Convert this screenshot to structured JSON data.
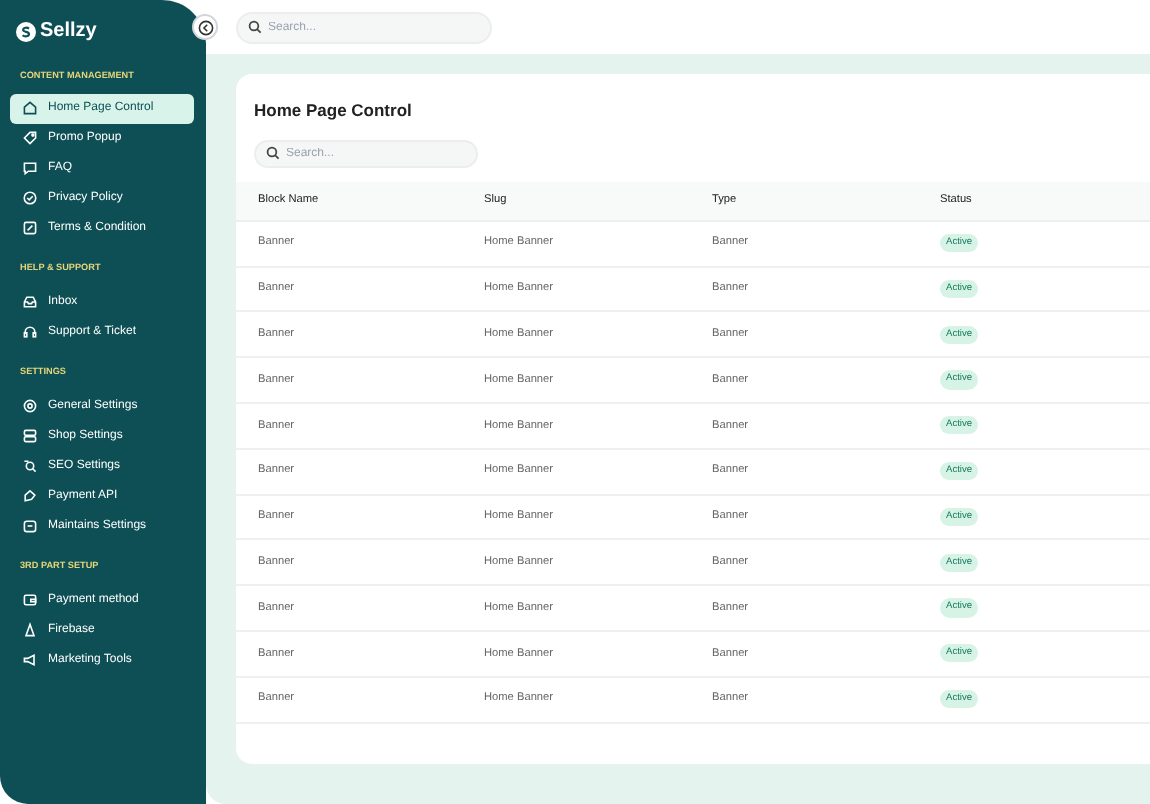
{
  "sidebar": {
    "logo": "Sellzy",
    "sections": [
      {
        "title": "CONTENT MANAGEMENT",
        "items": [
          {
            "label": "Home Page Control",
            "selected": true
          },
          {
            "label": "Promo Popup",
            "selected": false
          },
          {
            "label": "FAQ",
            "selected": false
          },
          {
            "label": "Privacy Policy",
            "selected": false
          },
          {
            "label": "Terms & Condition",
            "selected": false
          }
        ]
      },
      {
        "title": "HELP & SUPPORT",
        "items": [
          {
            "label": "Inbox",
            "selected": false
          },
          {
            "label": "Support & Ticket",
            "selected": false
          }
        ]
      },
      {
        "title": "SETTINGS",
        "items": [
          {
            "label": "General Settings",
            "selected": false
          },
          {
            "label": "Shop Settings",
            "selected": false
          },
          {
            "label": "SEO Settings",
            "selected": false
          },
          {
            "label": "Payment API",
            "selected": false
          },
          {
            "label": "Maintains Settings",
            "selected": false
          }
        ]
      },
      {
        "title": "3RD PART SETUP",
        "items": [
          {
            "label": "Payment method",
            "selected": false
          },
          {
            "label": "Firebase",
            "selected": false
          },
          {
            "label": "Marketing Tools",
            "selected": false
          }
        ]
      }
    ]
  },
  "top_search": {
    "placeholder": "Search..."
  },
  "panel": {
    "title": "Home Page Control",
    "search": {
      "placeholder": "Search..."
    },
    "table": {
      "columns": [
        "Block Name",
        "Slug",
        "Type",
        "Status"
      ],
      "rows": [
        [
          "Banner",
          "Home Banner",
          "Banner",
          "Active"
        ],
        [
          "Banner",
          "Home Banner",
          "Banner",
          "Active"
        ],
        [
          "Banner",
          "Home Banner",
          "Banner",
          "Active"
        ],
        [
          "Banner",
          "Home Banner",
          "Banner",
          "Active"
        ],
        [
          "Banner",
          "Home Banner",
          "Banner",
          "Active"
        ],
        [
          "Banner",
          "Home Banner",
          "Banner",
          "Active"
        ],
        [
          "Banner",
          "Home Banner",
          "Banner",
          "Active"
        ],
        [
          "Banner",
          "Home Banner",
          "Banner",
          "Active"
        ],
        [
          "Banner",
          "Home Banner",
          "Banner",
          "Active"
        ],
        [
          "Banner",
          "Home Banner",
          "Banner",
          "Active"
        ],
        [
          "Banner",
          "Home Banner",
          "Banner",
          "Active"
        ]
      ]
    }
  }
}
